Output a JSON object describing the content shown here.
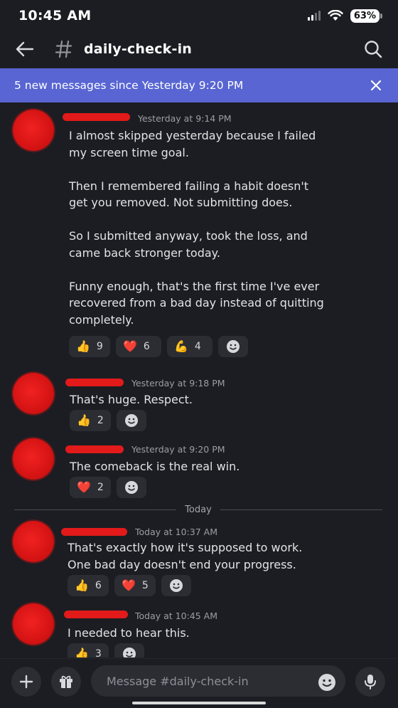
{
  "status_bar": {
    "time": "10:45 AM",
    "battery": "63%"
  },
  "header": {
    "channel": "daily-check-in"
  },
  "banner": {
    "text": "5 new messages since Yesterday 9:20 PM"
  },
  "divider": {
    "label": "Today"
  },
  "messages": [
    {
      "timestamp": "Yesterday at 9:14 PM",
      "text": "I almost skipped yesterday because I failed\nmy screen time goal.\n\nThen I remembered failing a habit doesn't\nget you removed. Not submitting does.\n\nSo I submitted anyway, took the loss, and\ncame back stronger today.\n\nFunny enough, that's the first time I've ever\nrecovered from a bad day instead of quitting\ncompletely.",
      "reactions": [
        {
          "emoji": "👍",
          "count": "9"
        },
        {
          "emoji": "❤️",
          "count": "6"
        },
        {
          "emoji": "💪",
          "count": "4"
        }
      ]
    },
    {
      "timestamp": "Yesterday at 9:18 PM",
      "text": "That's huge. Respect.",
      "reactions": [
        {
          "emoji": "👍",
          "count": "2"
        }
      ]
    },
    {
      "timestamp": "Yesterday at 9:20 PM",
      "text": "The comeback is the real win.",
      "reactions": [
        {
          "emoji": "❤️",
          "count": "2"
        }
      ]
    },
    {
      "timestamp": "Today at 10:37 AM",
      "text": "That's exactly how it's supposed to work.\nOne bad day doesn't end your progress.",
      "reactions": [
        {
          "emoji": "👍",
          "count": "6"
        },
        {
          "emoji": "❤️",
          "count": "5"
        }
      ]
    },
    {
      "timestamp": "Today at 10:45 AM",
      "text": "I needed to hear this.",
      "reactions": [
        {
          "emoji": "👍",
          "count": "3"
        }
      ]
    }
  ],
  "composer": {
    "placeholder": "Message #daily-check-in"
  },
  "colors": {
    "banner": "#5865d2",
    "background": "#1c1d22",
    "redaction": "#e21a1a"
  },
  "icons": {
    "back": "arrow-left-icon",
    "channel": "hash-icon",
    "search": "search-icon",
    "close": "close-icon",
    "add": "plus-icon",
    "gift": "gift-icon",
    "emoji": "smiley-icon",
    "mic": "microphone-icon",
    "add_reaction": "add-reaction-icon"
  }
}
